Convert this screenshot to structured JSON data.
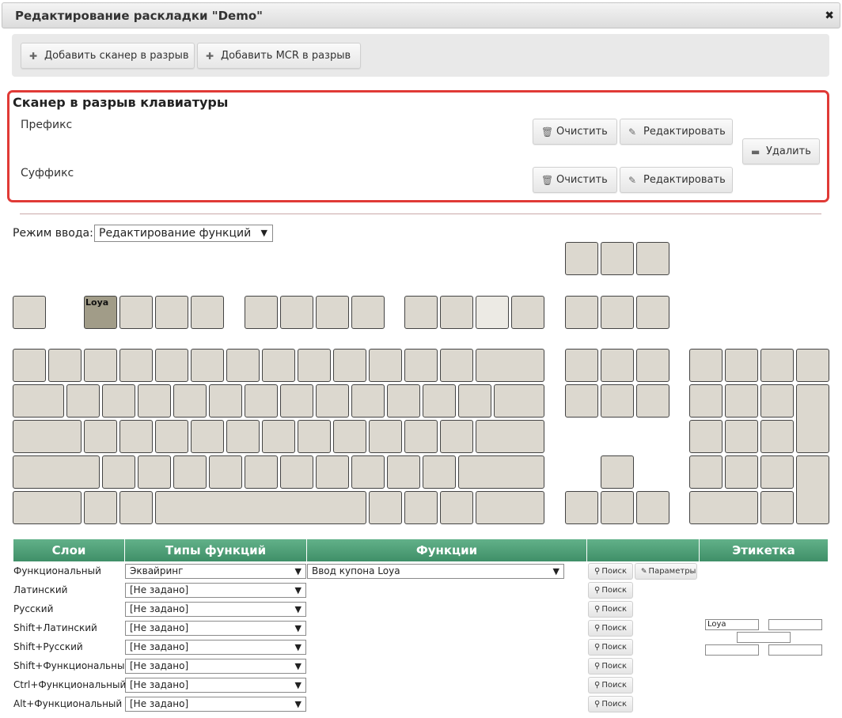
{
  "dialog": {
    "title": "Редактирование раскладки \"Demo\"",
    "close_glyph": "✖"
  },
  "toolbar": {
    "add_scanner_label": "Добавить сканер в разрыв",
    "add_mcr_label": "Добавить MCR в разрыв",
    "plus_glyph": "✚"
  },
  "scanner": {
    "title": "Сканер в разрыв клавиатуры",
    "prefix_label": "Префикс",
    "suffix_label": "Суффикс",
    "clear_label": "Очистить",
    "edit_label": "Редактировать",
    "delete_label": "Удалить",
    "trash_glyph": "🗑",
    "pencil_glyph": "✎",
    "minus_glyph": "▬"
  },
  "mode": {
    "label": "Режим ввода:",
    "value": "Редактирование функций",
    "arrow": "▼"
  },
  "keyboard": {
    "highlighted_key_label": "Loya"
  },
  "table": {
    "headers": {
      "layers": "Слои",
      "function_types": "Типы функций",
      "functions": "Функции",
      "label": "Этикетка"
    },
    "search_label": "Поиск",
    "params_label": "Параметры",
    "search_glyph": "⚲",
    "arrow": "▼",
    "rows": [
      {
        "layer": "Функциональный",
        "type": "Эквайринг",
        "function": "Ввод купона Loya"
      },
      {
        "layer": "Латинский",
        "type": "[Не задано]"
      },
      {
        "layer": "Русский",
        "type": "[Не задано]"
      },
      {
        "layer": "Shift+Латинский",
        "type": "[Не задано]"
      },
      {
        "layer": "Shift+Русский",
        "type": "[Не задано]"
      },
      {
        "layer": "Shift+Функциональный",
        "type": "[Не задано]"
      },
      {
        "layer": "Ctrl+Функциональный",
        "type": "[Не задано]"
      },
      {
        "layer": "Alt+Функциональный",
        "type": "[Не задано]"
      }
    ],
    "label_fields": [
      "Loya",
      "",
      "",
      "",
      ""
    ]
  },
  "colors": {
    "accent_border": "#e03a36",
    "header_green": "#4a9a72",
    "key_fill": "#dcd8cf",
    "key_highlight": "#a19c88"
  }
}
